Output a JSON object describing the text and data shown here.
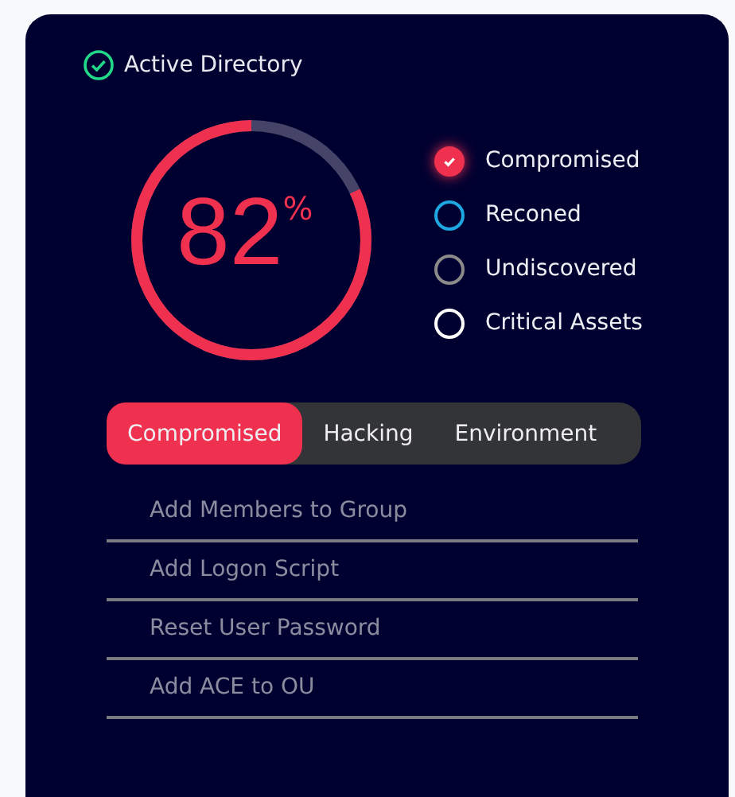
{
  "header": {
    "title": "Active Directory"
  },
  "gauge": {
    "level": 0.82,
    "value": "82",
    "unit": "%"
  },
  "legend": [
    {
      "label": "Compromised",
      "checked": true,
      "color": "#f0304f"
    },
    {
      "label": "Reconed",
      "checked": false,
      "color": "#1ea7e0"
    },
    {
      "label": "Undiscovered",
      "checked": false,
      "color": "#8a8a8a"
    },
    {
      "label": "Critical Assets",
      "checked": false,
      "color": "#ffffff"
    }
  ],
  "tabs": [
    {
      "label": "Compromised",
      "selected": true
    },
    {
      "label": "Hacking",
      "selected": false
    },
    {
      "label": "Environment",
      "selected": false
    }
  ],
  "items": [
    "Add Members to Group",
    "Add Logon Script",
    "Reset User Password",
    "Add ACE to OU"
  ]
}
